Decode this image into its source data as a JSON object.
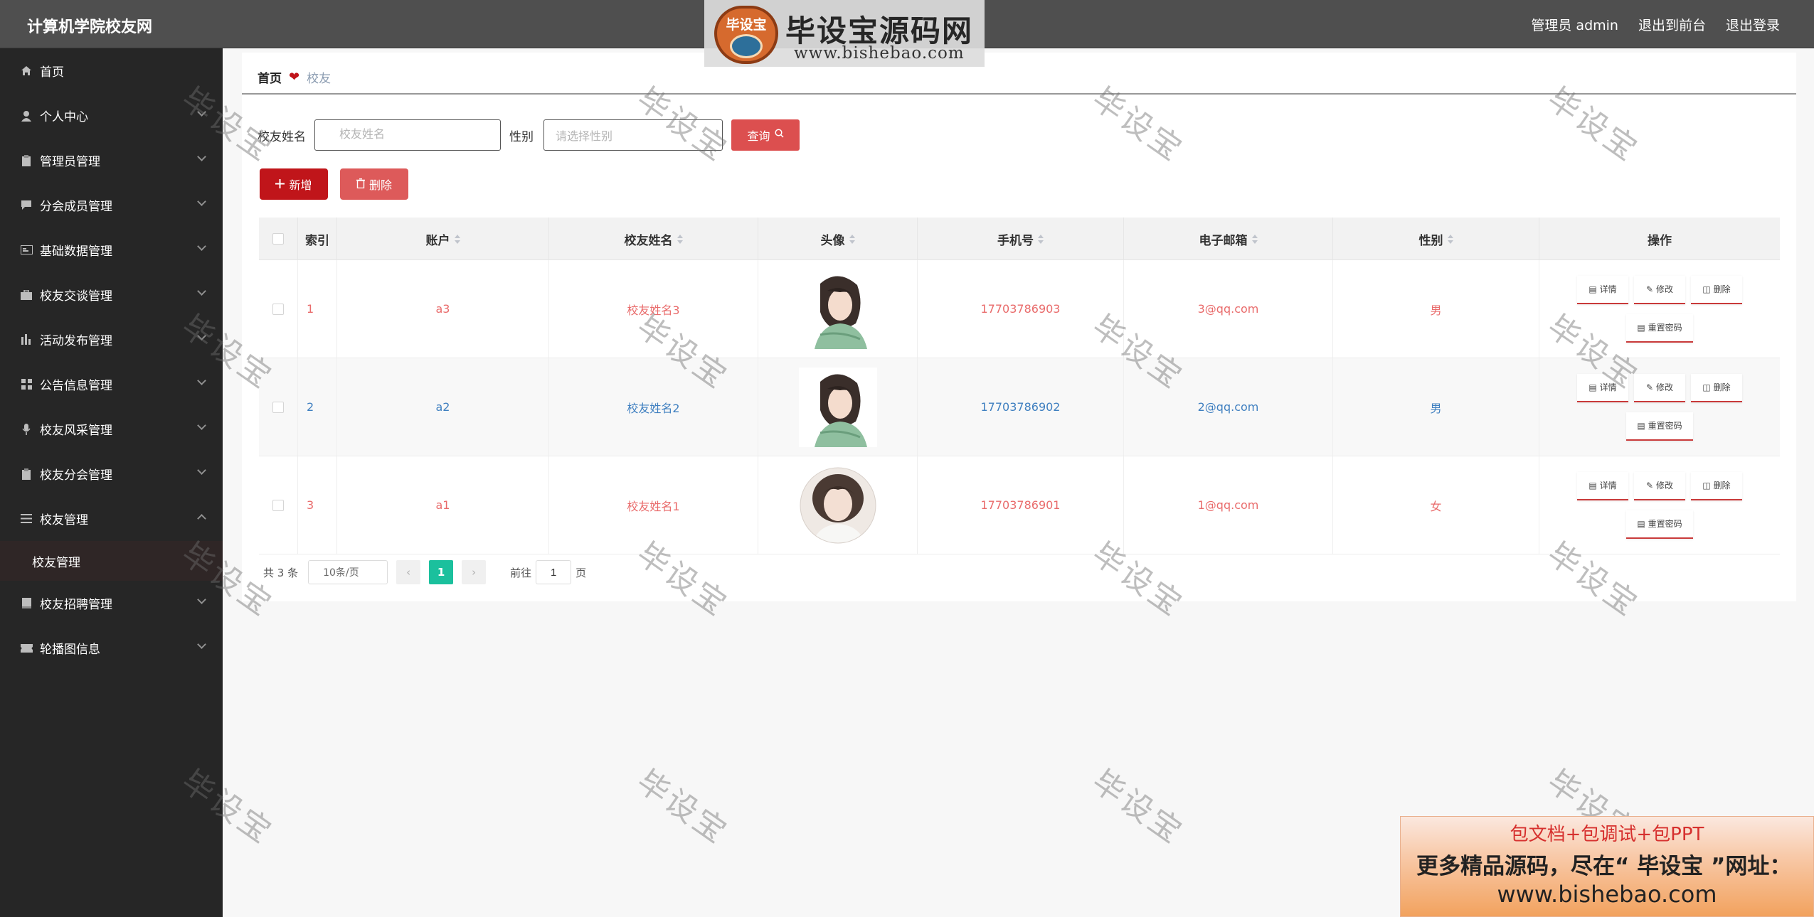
{
  "app": {
    "title": "计算机学院校友网",
    "top_links": [
      "管理员 admin",
      "退出到前台",
      "退出登录"
    ]
  },
  "watermark_logo": {
    "badge": "毕设宝",
    "title": "毕设宝源码网",
    "url": "www.bishebao.com"
  },
  "watermark_text": "毕设宝",
  "sidebar": {
    "items": [
      {
        "label": "首页",
        "icon": "home-icon"
      },
      {
        "label": "个人中心",
        "icon": "user-icon"
      },
      {
        "label": "管理员管理",
        "icon": "clipboard-icon"
      },
      {
        "label": "分会成员管理",
        "icon": "chat-icon"
      },
      {
        "label": "基础数据管理",
        "icon": "card-icon"
      },
      {
        "label": "校友交谈管理",
        "icon": "briefcase-icon"
      },
      {
        "label": "活动发布管理",
        "icon": "bars-icon"
      },
      {
        "label": "公告信息管理",
        "icon": "grid-icon"
      },
      {
        "label": "校友风采管理",
        "icon": "mic-icon"
      },
      {
        "label": "校友分会管理",
        "icon": "clipboard-icon"
      },
      {
        "label": "校友管理",
        "icon": "list-icon"
      },
      {
        "label": "校友招聘管理",
        "icon": "book-icon"
      },
      {
        "label": "轮播图信息",
        "icon": "ticket-icon"
      }
    ],
    "sub_item": "校友管理"
  },
  "breadcrumb": {
    "home": "首页",
    "current": "校友"
  },
  "search": {
    "name_label": "校友姓名",
    "name_placeholder": "校友姓名",
    "gender_label": "性别",
    "gender_placeholder": "请选择性别",
    "query_label": "查询"
  },
  "actions": {
    "add": "新增",
    "delete": "删除"
  },
  "table": {
    "columns": [
      "索引",
      "账户",
      "校友姓名",
      "头像",
      "手机号",
      "电子邮箱",
      "性别",
      "操作"
    ],
    "rows": [
      {
        "index": "1",
        "account": "a3",
        "name": "校友姓名3",
        "phone": "17703786903",
        "email": "3@qq.com",
        "gender": "男"
      },
      {
        "index": "2",
        "account": "a2",
        "name": "校友姓名2",
        "phone": "17703786902",
        "email": "2@qq.com",
        "gender": "男"
      },
      {
        "index": "3",
        "account": "a1",
        "name": "校友姓名1",
        "phone": "17703786901",
        "email": "1@qq.com",
        "gender": "女"
      }
    ],
    "ops": {
      "detail": "详情",
      "edit": "修改",
      "delete": "删除",
      "reset": "重置密码"
    }
  },
  "pager": {
    "total": "共 3 条",
    "page_size": "10条/页",
    "current_page": "1",
    "goto_label": "前往",
    "goto_value": "1",
    "page_suffix": "页"
  },
  "promo": {
    "line1": "包文档+包调试+包PPT",
    "line2": "更多精品源码，尽在“ 毕设宝 ”网址：",
    "line3": "www.bishebao.com"
  },
  "colors": {
    "accent": "#c0151a",
    "query": "#dc4f4f",
    "pager_active": "#1bc09d",
    "row_red": "#e96b6b",
    "row_blue": "#3f7fc0"
  }
}
